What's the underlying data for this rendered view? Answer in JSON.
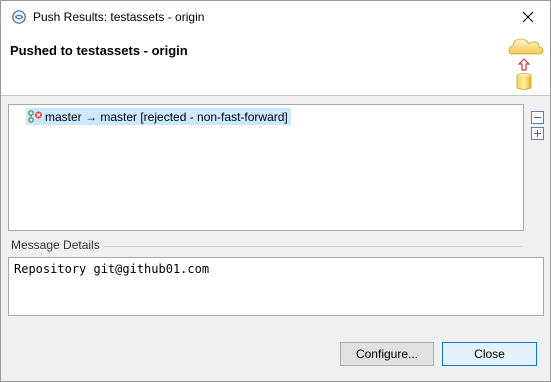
{
  "window": {
    "title": "Push Results: testassets - origin",
    "banner_title": "Pushed to testassets - origin"
  },
  "results": {
    "items": [
      {
        "label": "master → master [rejected - non-fast-forward]",
        "icon": "push-rejected-icon"
      }
    ],
    "collapse_all": "collapse-all",
    "expand_all": "expand-all"
  },
  "message": {
    "label": "Message Details",
    "text": "Repository git@github01.com"
  },
  "buttons": {
    "configure": "Configure...",
    "close": "Close"
  },
  "colors": {
    "selection": "#cce8ff",
    "default_button_border": "#0078d7"
  }
}
